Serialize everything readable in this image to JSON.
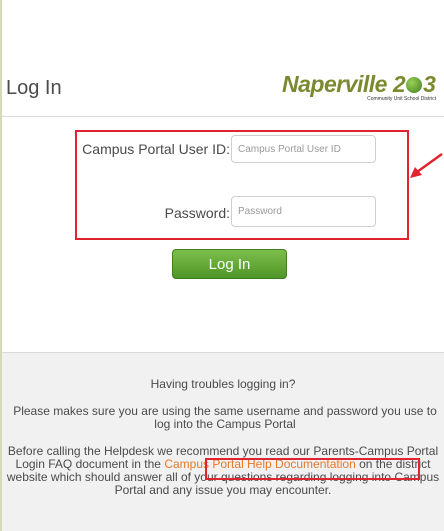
{
  "header": {
    "title": "Log In",
    "logo_text_left": "Naperville 2",
    "logo_text_right": "3",
    "logo_subtitle": "Community Unit School District"
  },
  "form": {
    "userid_label": "Campus Portal User ID:",
    "userid_placeholder": "Campus Portal User ID",
    "password_label": "Password:",
    "password_placeholder": "Password",
    "login_button": "Log In"
  },
  "footer": {
    "trouble_heading": "Having troubles logging in?",
    "same_credentials": "Please makes sure you are using the same username and password you use to log into the Campus Portal",
    "helpdesk_before": "Before calling the Helpdesk we recommend you read our Parents-Campus Portal Login FAQ document in the",
    "help_link": "Campus Portal Help Documentation",
    "helpdesk_after": "on the district website which should answer all of your questions regarding logging into Campus Portal and any issue you may encounter."
  },
  "annotation_color": "#e0232e",
  "button_color": "#5fa534",
  "link_color": "#e8782a"
}
